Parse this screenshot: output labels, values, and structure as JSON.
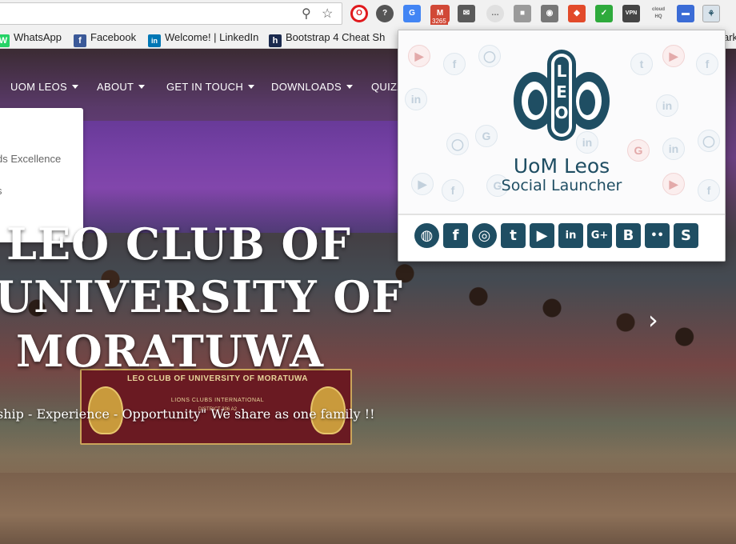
{
  "bookmarks": [
    {
      "label": "WhatsApp",
      "fav": "W",
      "color": "#25d366"
    },
    {
      "label": "Facebook",
      "fav": "f",
      "color": "#3b5998"
    },
    {
      "label": "Welcome! | LinkedIn",
      "fav": "in",
      "color": "#0077b5"
    },
    {
      "label": "Bootstrap 4 Cheat Sh",
      "fav": "h",
      "color": "#1b2a4e"
    },
    {
      "label": "ark",
      "fav": "",
      "color": ""
    }
  ],
  "extensions": {
    "gmail_count": "3265",
    "vpn_label": "VPN",
    "cloud_label": "cloud HQ"
  },
  "nav": {
    "items": [
      "UOM LEOS",
      "ABOUT",
      "GET IN TOUCH",
      "DOWNLOADS",
      "QUIZZ"
    ]
  },
  "dropdown": {
    "items": [
      "ds Excellence",
      "s"
    ]
  },
  "hero": {
    "headline": [
      "LEO CLUB OF",
      "UNIVERSITY OF",
      "MORATUWA"
    ],
    "tagline": "ship - Experience - Opportunity\" We share as one family !!",
    "banner_title": "LEO CLUB OF UNIVERSITY OF MORATUWA",
    "banner_sub": "LIONS CLUBS INTERNATIONAL",
    "banner_dist": "DISTRICT 306 A2"
  },
  "popup": {
    "logo_text": "LEO",
    "title": "UoM Leos",
    "subtitle": "Social Launcher",
    "social": [
      {
        "name": "website-icon",
        "glyph": "◍"
      },
      {
        "name": "facebook-icon",
        "glyph": "f"
      },
      {
        "name": "instagram-icon",
        "glyph": "◎"
      },
      {
        "name": "twitter-icon",
        "glyph": "t"
      },
      {
        "name": "youtube-icon",
        "glyph": "▶"
      },
      {
        "name": "linkedin-icon",
        "glyph": "in"
      },
      {
        "name": "google-plus-icon",
        "glyph": "G+"
      },
      {
        "name": "blogger-icon",
        "glyph": "B"
      },
      {
        "name": "flickr-icon",
        "glyph": "••"
      },
      {
        "name": "slideshare-icon",
        "glyph": "S"
      }
    ]
  },
  "colors": {
    "brand": "#1f4e63",
    "gmail": "#d14836"
  }
}
